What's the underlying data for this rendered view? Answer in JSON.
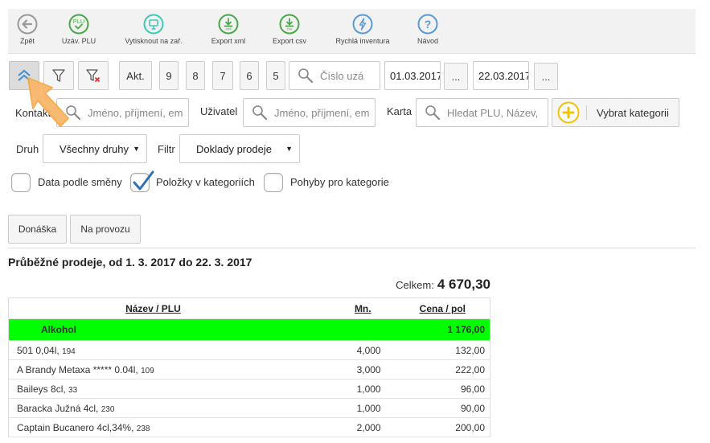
{
  "toolbar": [
    {
      "label": "Zpět",
      "icon": "back-arrow-icon"
    },
    {
      "label": "Uzáv. PLU",
      "icon": "plu-close-icon",
      "icon_text": "PLU"
    },
    {
      "label": "Vytisknout na zař.",
      "icon": "print-device-icon"
    },
    {
      "label": "Export xml",
      "icon": "export-xml-icon",
      "icon_text": "xml"
    },
    {
      "label": "Export csv",
      "icon": "export-csv-icon",
      "icon_text": "csv"
    },
    {
      "label": "Rychlá inventura",
      "icon": "lightning-icon"
    },
    {
      "label": "Návod",
      "icon": "help-icon",
      "icon_text": "?"
    }
  ],
  "colors": {
    "gray_icon": "#9a9a9a",
    "green_icon": "#4aa84a",
    "teal_icon": "#3cc9b8",
    "blue_icon": "#5b9bd5",
    "category_bg": "#00ff00",
    "cursor_fill": "#f8b76b"
  },
  "filters": {
    "collapse_icon": "double-chevron-up-icon",
    "filter_icon": "funnel-icon",
    "clear_filter_icon": "funnel-clear-icon",
    "akt_label": "Akt.",
    "quick_days": [
      "9",
      "8",
      "7",
      "6",
      "5"
    ],
    "doc_number_placeholder": "Číslo uzá",
    "date_from": "01.03.2017",
    "date_to": "22.03.2017",
    "date_picker_label": "...",
    "contact_label": "Kontakt",
    "contact_placeholder": "Jméno, příjmení, em",
    "user_label": "Uživatel",
    "user_placeholder": "Jméno, příjmení, em",
    "card_label": "Karta",
    "card_placeholder": "Hledat PLU, Název,",
    "category_button": "Vybrat kategorii",
    "druh_label": "Druh",
    "druh_value": "Všechny druhy",
    "filtr_label": "Filtr",
    "filtr_value": "Doklady prodeje",
    "select_arrow": "▼",
    "checkboxes": [
      {
        "label": "Data podle směny",
        "checked": false
      },
      {
        "label": "Položky v kategoriích",
        "checked": true
      },
      {
        "label": "Pohyby pro kategorie",
        "checked": false
      }
    ]
  },
  "tabs": [
    "Donáška",
    "Na provozu"
  ],
  "report": {
    "title": "Průběžné prodeje, od 1. 3. 2017 do 22. 3. 2017",
    "total_label": "Celkem:",
    "total_value": "4 670,30",
    "columns": {
      "name": "Název",
      "sep": " / ",
      "plu": "PLU",
      "qty": "Mn.",
      "price": "Cena / pol"
    },
    "category": {
      "name": "Alkohol",
      "total": "1 176,00"
    },
    "rows": [
      {
        "name": "501 0,04l,",
        "plu": "194",
        "qty": "4,000",
        "price": "132,00"
      },
      {
        "name": "A Brandy Metaxa ***** 0.04l,",
        "plu": "109",
        "qty": "3,000",
        "price": "222,00"
      },
      {
        "name": "Baileys 8cl,",
        "plu": "33",
        "qty": "1,000",
        "price": "96,00"
      },
      {
        "name": "Baracka Južná 4cl,",
        "plu": "230",
        "qty": "1,000",
        "price": "90,00"
      },
      {
        "name": "Captain Bucanero 4cl,34%,",
        "plu": "238",
        "qty": "2,000",
        "price": "200,00"
      }
    ]
  }
}
